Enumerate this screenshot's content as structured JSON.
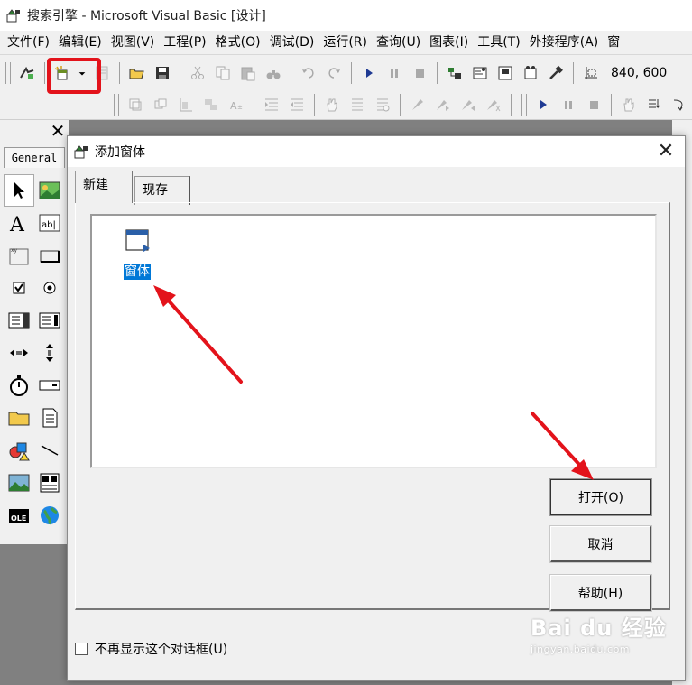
{
  "window": {
    "title": "搜索引擎 - Microsoft Visual Basic [设计]"
  },
  "menubar": {
    "items": [
      "文件(F)",
      "编辑(E)",
      "视图(V)",
      "工程(P)",
      "格式(O)",
      "调试(D)",
      "运行(R)",
      "查询(U)",
      "图表(I)",
      "工具(T)",
      "外接程序(A)",
      "窗"
    ]
  },
  "toolbar": {
    "position_readout": "840, 600",
    "highlight_color": "#e3131b"
  },
  "toolbox": {
    "tab_label": "General",
    "close_glyph": "✕"
  },
  "dialog": {
    "title": "添加窗体",
    "close_glyph": "✕",
    "tabs": [
      "新建",
      "现存"
    ],
    "active_tab": "新建",
    "items": [
      {
        "label": "窗体",
        "icon": "form-icon",
        "selected": true
      }
    ],
    "buttons": {
      "open": "打开(O)",
      "cancel": "取消",
      "help": "帮助(H)"
    },
    "checkbox_label": "不再显示这个对话框(U)",
    "checkbox_checked": false
  },
  "annotations": {
    "arrow_color": "#e3131b"
  },
  "watermark": {
    "brand": "Bai du 经验",
    "url": "jingyan.baidu.com"
  },
  "colors": {
    "selection": "#0078d7",
    "workspace": "#808080",
    "chrome": "#f0f0f0"
  }
}
